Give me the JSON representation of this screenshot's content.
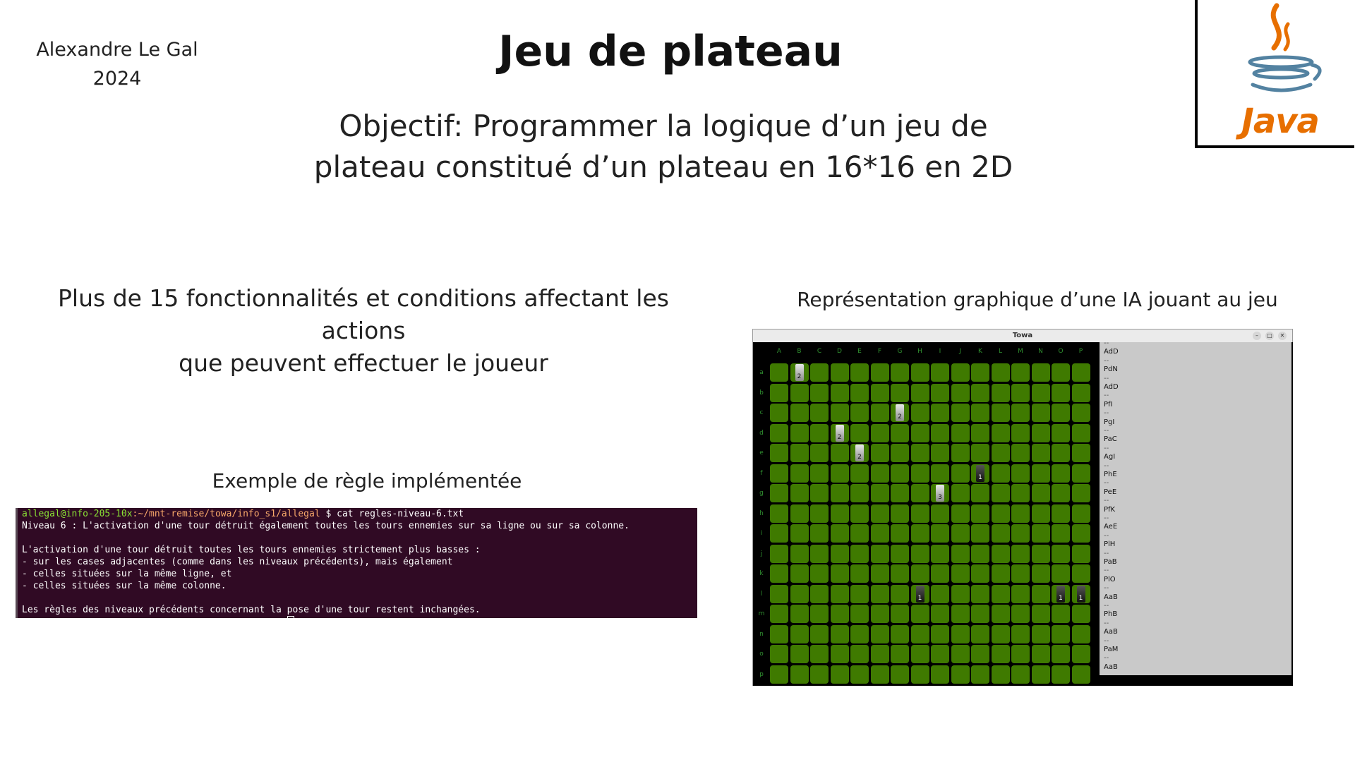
{
  "header": {
    "author": "Alexandre Le Gal",
    "year": "2024",
    "title": "Jeu de plateau",
    "objective_line1": "Objectif: Programmer la logique d’un jeu de",
    "objective_line2": "plateau constitué d’un plateau en 16*16 en 2D"
  },
  "logo": {
    "wordmark": "Java",
    "icon": "java-coffee-cup-icon",
    "color": "#e76f00"
  },
  "features": {
    "line1": "Plus de 15 fonctionnalités et conditions affectant les actions",
    "line2": "que peuvent effectuer le joueur"
  },
  "captions": {
    "ia": "Représentation graphique d’une IA jouant au jeu",
    "rule": "Exemple de règle implémentée"
  },
  "terminal": {
    "prompt_user": "allegal@info-205-10x",
    "prompt_path": ":~/mnt-remise/towa/info_s1/allegal",
    "command": " $ cat regles-niveau-6.txt",
    "lines": [
      "Niveau 6 : L'activation d'une tour détruit également toutes les tours ennemies sur sa ligne ou sur sa colonne.",
      "",
      "L'activation d'une tour détruit toutes les tours ennemies strictement plus basses :",
      "- sur les cases adjacentes (comme dans les niveaux précédents), mais également",
      "- celles situées sur la même ligne, et",
      "- celles situées sur la même colonne.",
      "",
      "Les règles des niveaux précédents concernant la pose d'une tour restent inchangées."
    ]
  },
  "game": {
    "window_title": "Towa",
    "columns": [
      "A",
      "B",
      "C",
      "D",
      "E",
      "F",
      "G",
      "H",
      "I",
      "J",
      "K",
      "L",
      "M",
      "N",
      "O",
      "P"
    ],
    "rows": [
      "a",
      "b",
      "c",
      "d",
      "e",
      "f",
      "g",
      "h",
      "i",
      "j",
      "k",
      "l",
      "m",
      "n",
      "o",
      "p"
    ],
    "towers": [
      {
        "row": 0,
        "col": 1,
        "color": "white",
        "height": "2"
      },
      {
        "row": 2,
        "col": 6,
        "color": "white",
        "height": "2"
      },
      {
        "row": 3,
        "col": 3,
        "color": "white",
        "height": "2"
      },
      {
        "row": 4,
        "col": 4,
        "color": "white",
        "height": "2"
      },
      {
        "row": 5,
        "col": 10,
        "color": "black",
        "height": "1"
      },
      {
        "row": 6,
        "col": 8,
        "color": "white",
        "height": "3"
      },
      {
        "row": 11,
        "col": 7,
        "color": "black",
        "height": "1"
      },
      {
        "row": 11,
        "col": 14,
        "color": "black",
        "height": "1"
      },
      {
        "row": 11,
        "col": 15,
        "color": "black",
        "height": "1"
      }
    ],
    "log": [
      "AdD",
      "PdN",
      "AdD",
      "PfI",
      "PgI",
      "PaC",
      "AgI",
      "PhE",
      "PeE",
      "PfK",
      "AeE",
      "PlH",
      "PaB",
      "PlO",
      "AaB",
      "PhB",
      "AaB",
      "PaM",
      "AaB"
    ],
    "log_separator": "--"
  }
}
